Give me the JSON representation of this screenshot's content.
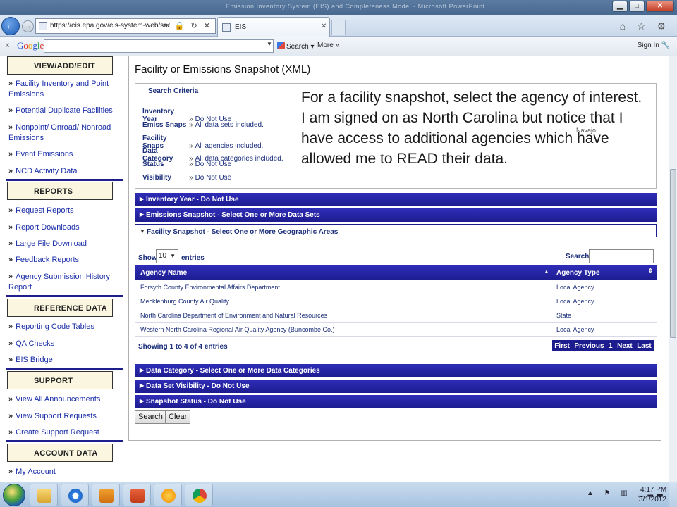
{
  "window": {
    "title": "Emission Inventory System (EIS) and Completeness Model - Microsoft PowerPoint",
    "controls": {
      "minimize": "▁",
      "maximize": "□",
      "close": "✕"
    }
  },
  "browser": {
    "back_icon": "←",
    "forward_icon": "→",
    "url": "https://eis.epa.gov/eis-system-web/snapshot",
    "url_tools": "▾ 🔒 ↻ ✕",
    "tab_label": "EIS",
    "tab_close": "✕",
    "right_icons": "⌂ ☆ ⚙"
  },
  "google_toolbar": {
    "close": "x",
    "logo_letters": [
      "G",
      "o",
      "o",
      "g",
      "l",
      "e"
    ],
    "dropdown": "▼",
    "search_label": "Search",
    "search_caret": "▾",
    "more_label": "More »",
    "sign_in": "Sign In",
    "wrench_icon": "🔧"
  },
  "sidebar": {
    "sections": [
      {
        "heading": "VIEW/ADD/EDIT",
        "links": [
          "Facility Inventory and Point Emissions",
          "Potential Duplicate Facilities",
          "Nonpoint/ Onroad/ Nonroad Emissions",
          "Event Emissions",
          "NCD Activity Data"
        ]
      },
      {
        "heading": "REPORTS",
        "links": [
          "Request Reports",
          "Report Downloads",
          "Large File Download",
          "Feedback Reports",
          "Agency Submission History Report"
        ]
      },
      {
        "heading": "REFERENCE DATA",
        "links": [
          "Reporting Code Tables",
          "QA Checks",
          "EIS Bridge"
        ]
      },
      {
        "heading": "SUPPORT",
        "links": [
          "View All Announcements",
          "View Support Requests",
          "Create Support Request"
        ]
      },
      {
        "heading": "ACCOUNT DATA",
        "links": [
          "My Account"
        ]
      }
    ],
    "raquo": "»"
  },
  "main": {
    "page_title": "Facility or Emissions Snapshot (XML)",
    "criteria": {
      "title": "Search Criteria",
      "rows": [
        {
          "key": "Inventory Year",
          "value": "Do Not Use"
        },
        {
          "key": "Emiss Snaps",
          "value": "All data sets included."
        },
        {
          "key": "Facility Snaps",
          "value": "All agencies included."
        },
        {
          "key": "Data Category",
          "value": "All data categories included."
        },
        {
          "key": "Status",
          "value": "Do Not Use"
        },
        {
          "key": "Visibility",
          "value": "Do Not Use"
        }
      ]
    },
    "callout": "For a facility snapshot, select the agency of interest.  I am signed on as North Carolina but notice that I have access to additional agencies which have allowed me to READ their data.",
    "navajo_label": "Navajo",
    "sections_top": [
      "Inventory Year - Do Not Use",
      "Emissions Snapshot - Select One or More Data Sets"
    ],
    "facility_section": "Facility Snapshot - Select One or More Geographic Areas",
    "sections_bottom": [
      "Data Category - Select One or More Data Categories",
      "Data Set Visibility - Do Not Use",
      "Snapshot Status - Do Not Use"
    ],
    "table": {
      "show_label": "Show",
      "page_size": "10",
      "entries_label": "entries",
      "search_label": "Search:",
      "columns": [
        "Agency Name",
        "Agency Type"
      ],
      "rows": [
        [
          "Forsyth County Environmental Affairs Department",
          "Local Agency"
        ],
        [
          "Mecklenburg County Air Quality",
          "Local Agency"
        ],
        [
          "North Carolina Department of Environment and Natural Resources",
          "State"
        ],
        [
          "Western North Carolina Regional Air Quality Agency (Buncombe Co.)",
          "Local Agency"
        ]
      ],
      "info": "Showing 1 to 4 of 4 entries",
      "pager": [
        "First",
        "Previous",
        "1",
        "Next",
        "Last"
      ]
    },
    "buttons": {
      "search": "Search",
      "clear": "Clear"
    }
  },
  "taskbar": {
    "apps": [
      "file-explorer",
      "internet-explorer",
      "outlook",
      "powerpoint",
      "app-orange",
      "chrome"
    ],
    "tray_icons": "▲ ⚑ ▥ ▁▂▃",
    "time": "4:17 PM",
    "date": "3/1/2012"
  },
  "colors": {
    "section_bar": "#1d1c8f",
    "link": "#1b2fa8",
    "sidebar_heading_bg": "#fbf6e0"
  }
}
